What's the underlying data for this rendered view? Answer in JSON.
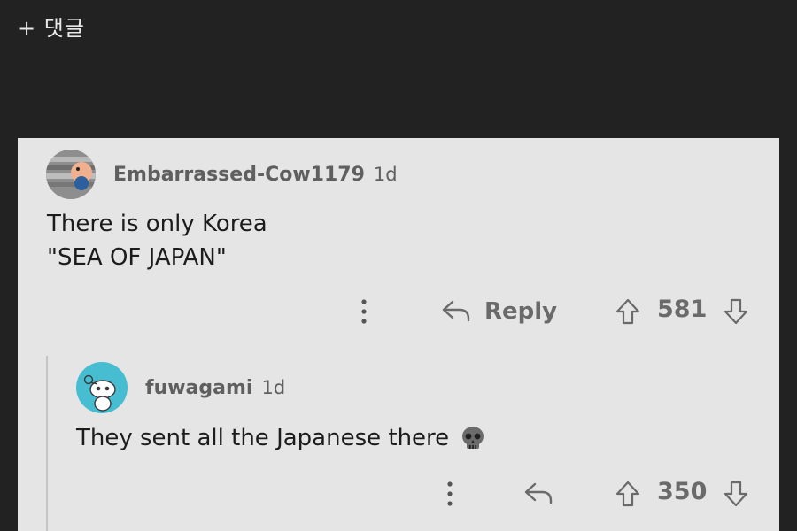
{
  "top_link": "+ 댓글",
  "comment": {
    "author": "Embarrassed-Cow1179",
    "age": "1d",
    "lines": [
      "There is only Korea",
      "\"SEA OF JAPAN\""
    ],
    "reply_label": "Reply",
    "score": "581"
  },
  "reply": {
    "author": "fuwagami",
    "age": "1d",
    "text": "They sent all the Japanese there",
    "emoji": "skull-icon",
    "score": "350"
  },
  "colors": {
    "page_bg": "#222222",
    "card_bg": "#e5e5e5",
    "meta_text": "#5f5f5f",
    "avatar_teal": "#46bdd0"
  }
}
